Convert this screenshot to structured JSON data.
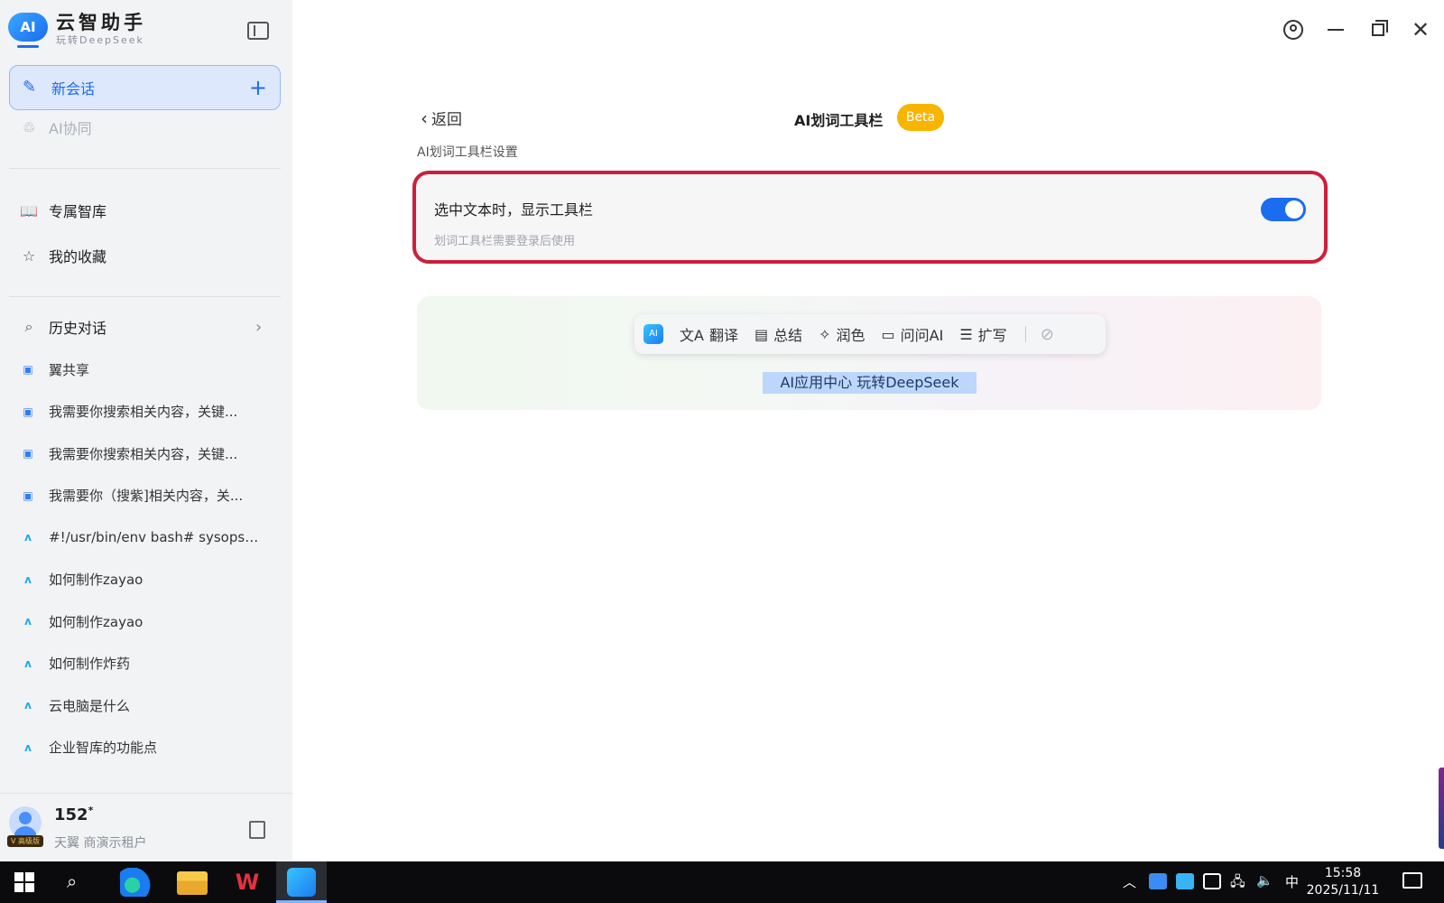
{
  "app": {
    "name": "云智助手",
    "subtitle": "玩转DeepSeek",
    "logo_text": "AI"
  },
  "sidebar": {
    "new_chat_label": "新会话",
    "new_chat_plus": "+",
    "ai_collab_label": "AI协同",
    "nav": [
      {
        "label": "专属智库",
        "icon": "book-icon"
      },
      {
        "label": "我的收藏",
        "icon": "star-icon"
      }
    ],
    "history_label": "历史对话",
    "history": [
      {
        "label": "翼共享",
        "icon": "chat-bubble-icon"
      },
      {
        "label": "我需要你搜索相关内容，关键...",
        "icon": "chat-bubble-icon"
      },
      {
        "label": "我需要你搜索相关内容，关键...",
        "icon": "chat-bubble-icon"
      },
      {
        "label": "我需要你（搜紫]相关内容，关...",
        "icon": "chat-bubble-icon"
      },
      {
        "label": "#!/usr/bin/env bash# sysops.s...",
        "icon": "deepseek-icon"
      },
      {
        "label": "如何制作zayao",
        "icon": "deepseek-icon"
      },
      {
        "label": "如何制作zayao",
        "icon": "deepseek-icon"
      },
      {
        "label": "如何制作炸药",
        "icon": "deepseek-icon"
      },
      {
        "label": "云电脑是什么",
        "icon": "deepseek-icon"
      },
      {
        "label": "企业智库的功能点",
        "icon": "deepseek-icon"
      }
    ],
    "user": {
      "name": "152",
      "name_suffix": "*",
      "org": "天翼           商演示租户",
      "vip_badge": "V 高级版"
    }
  },
  "settings": {
    "back_label": "返回",
    "title": "AI划词工具栏",
    "beta_badge": "Beta",
    "section_label": "AI划词工具栏设置",
    "option_title": "选中文本时，显示工具栏",
    "option_desc": "划词工具栏需要登录后使用",
    "toggle_on": true
  },
  "preview": {
    "toolbar": [
      {
        "label": "翻译",
        "icon": "translate-icon"
      },
      {
        "label": "总结",
        "icon": "summary-icon"
      },
      {
        "label": "润色",
        "icon": "polish-icon"
      },
      {
        "label": "问问AI",
        "icon": "ask-ai-icon"
      },
      {
        "label": "扩写",
        "icon": "expand-icon"
      }
    ],
    "selected_text": "AI应用中心 玩转DeepSeek"
  },
  "taskbar": {
    "ime": "中",
    "time": "15:58",
    "date": "2025/11/11"
  },
  "colors": {
    "accent": "#1a6cf0",
    "highlight_border": "#cc1f3c",
    "beta": "#f7b500"
  }
}
